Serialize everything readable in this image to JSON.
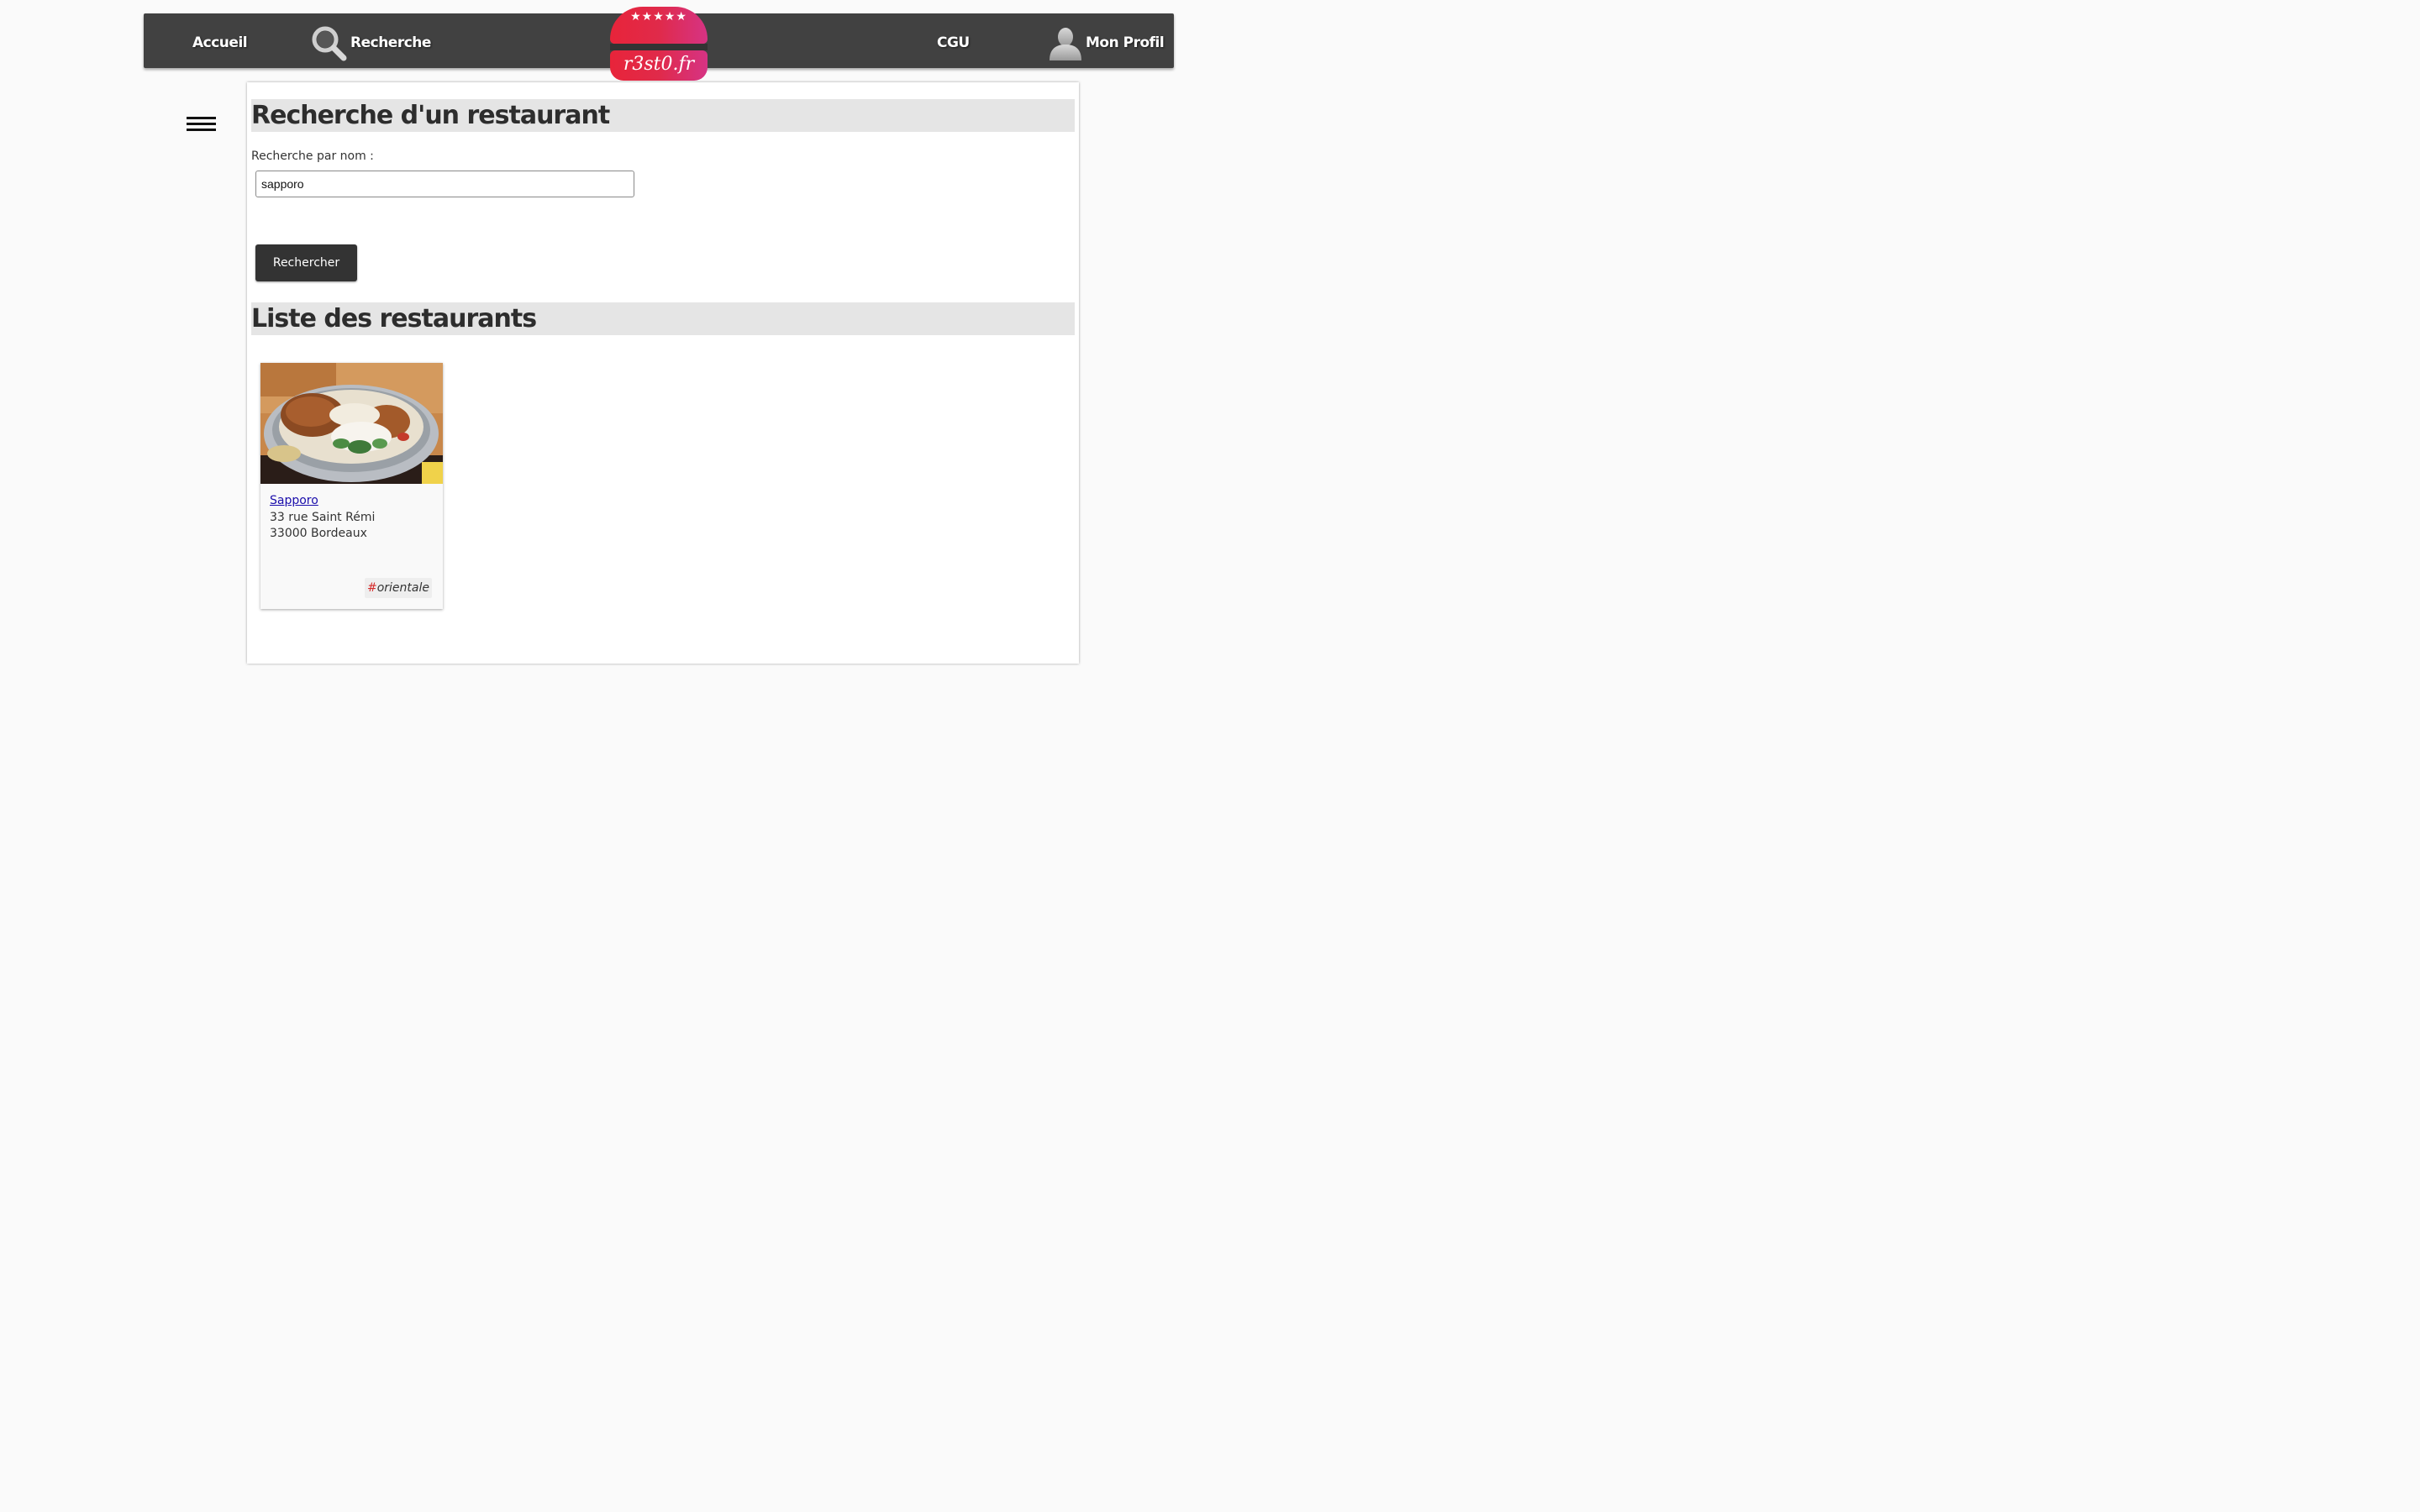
{
  "nav": {
    "accueil_label": "Accueil",
    "recherche_label": "Recherche",
    "cgu_label": "CGU",
    "profil_label": "Mon Profil",
    "search_icon": "search-icon",
    "profile_icon": "user-avatar-icon"
  },
  "logo": {
    "stars": "★★★★★",
    "text": "r3st0.fr",
    "colors": [
      "#e8243a",
      "#d63384"
    ]
  },
  "sidebar": {
    "menu_icon": "hamburger-menu-icon"
  },
  "search": {
    "title": "Recherche d'un restaurant",
    "label": "Recherche par nom :",
    "value": "sapporo",
    "button_label": "Rechercher"
  },
  "list": {
    "title": "Liste des restaurants",
    "restaurants": [
      {
        "name": "Sapporo",
        "street": "33 rue Saint Rémi",
        "city": "33000 Bordeaux",
        "tag_hash": "#",
        "tag_label": "orientale"
      }
    ]
  },
  "colors": {
    "navbar_bg": "#414141",
    "link": "#1a0dab",
    "tag_hash": "#d52b2b"
  }
}
